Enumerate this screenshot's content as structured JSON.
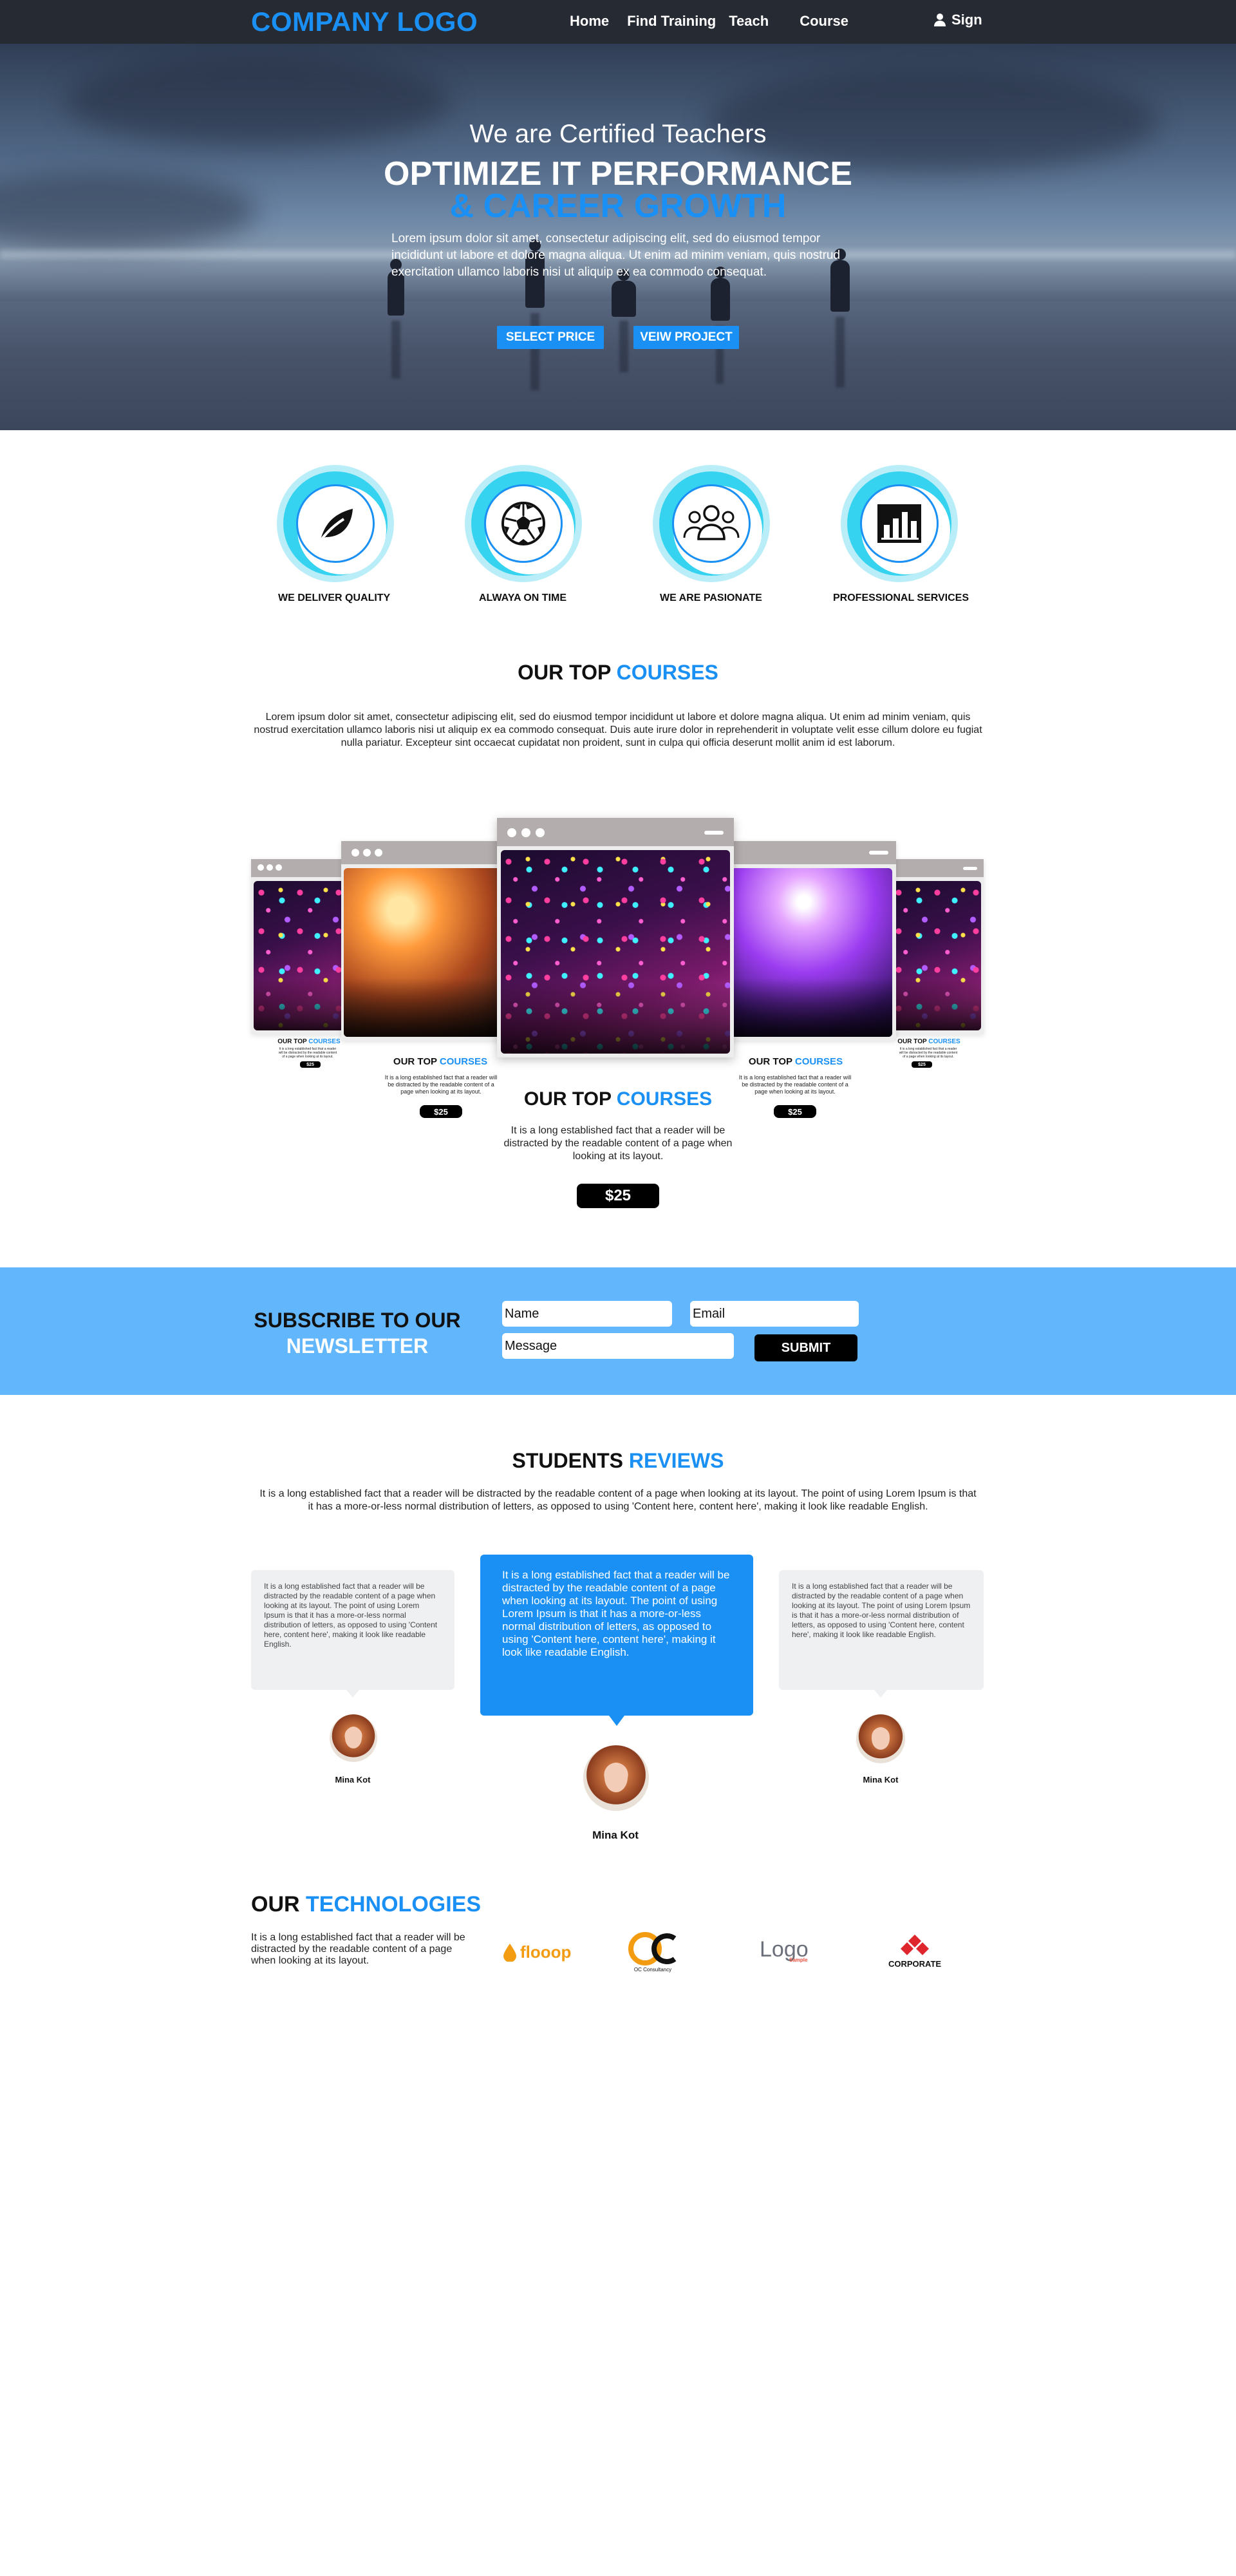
{
  "header": {
    "logo": "COMPANY LOGO",
    "nav": [
      "Home",
      "Find Training",
      "Teach",
      "Course"
    ],
    "sign": "Sign"
  },
  "hero": {
    "subtitle": "We are Certified Teachers",
    "title_line1": "OPTIMIZE IT PERFORMANCE",
    "title_line2": "& CAREER GROWTH",
    "text": "Lorem ipsum dolor sit amet, consectetur adipiscing elit, sed do eiusmod tempor incididunt ut labore et dolore magna aliqua. Ut enim ad minim veniam, quis nostrud exercitation ullamco laboris nisi ut aliquip ex ea commodo consequat.",
    "btn_price": "SELECT PRICE",
    "btn_project": "VEIW PROJECT"
  },
  "features": [
    {
      "label": "WE DELIVER QUALITY",
      "icon": "leaf-icon"
    },
    {
      "label": "ALWAYA ON TIME",
      "icon": "soccer-ball-icon"
    },
    {
      "label": "WE ARE PASIONATE",
      "icon": "team-icon"
    },
    {
      "label": "PROFESSIONAL SERVICES",
      "icon": "bar-chart-icon"
    }
  ],
  "courses": {
    "heading_a": "OUR TOP ",
    "heading_b": "COURSES",
    "intro": "Lorem ipsum dolor sit amet, consectetur adipiscing elit, sed do eiusmod tempor incididunt ut labore et dolore magna aliqua. Ut enim ad minim veniam, quis nostrud exercitation ullamco laboris nisi ut aliquip ex ea commodo consequat. Duis aute irure dolor in reprehenderit in voluptate velit esse cillum dolore eu fugiat nulla pariatur. Excepteur sint occaecat cupidatat non proident, sunt in culpa qui officia deserunt mollit anim id est laborum.",
    "card_heading_a": "OUR TOP ",
    "card_heading_b": "COURSES",
    "card_text": "It is a long established fact that a reader will be distracted by the readable content of a page when looking at its layout.",
    "card_price": "$25"
  },
  "newsletter": {
    "title_a": "SUBSCRIBE TO OUR",
    "title_b": "NEWSLETTER",
    "name_value": "Name",
    "email_value": "Email",
    "message_value": "Message",
    "submit": "SUBMIT"
  },
  "reviews": {
    "heading_a": "STUDENTS ",
    "heading_b": "REVIEWS",
    "intro": "It is a long established fact that a reader will be distracted by the readable content of a page when looking at its layout. The point of using Lorem Ipsum is that it has a more-or-less normal distribution of letters, as opposed to using 'Content here, content here', making it look like readable English.",
    "items": [
      {
        "text": "It is a long established fact that a reader will be distracted by the readable content of a page when looking at its layout. The point of using Lorem Ipsum is that it has a more-or-less normal distribution of letters, as opposed to using 'Content here, content here', making it look like readable English.",
        "name": "Mina Kot"
      },
      {
        "text": "It is a long established fact that a reader will be distracted by the readable content of a page when looking at its layout. The point of using Lorem Ipsum is that it has a more-or-less normal distribution of letters, as opposed to using 'Content here, content here', making it look like readable English.",
        "name": "Mina Kot"
      },
      {
        "text": "It is a long established fact that a reader will be distracted by the readable content of a page when looking at its layout. The point of using Lorem Ipsum is that it has a more-or-less normal distribution of letters, as opposed to using 'Content here, content here', making it look like readable English.",
        "name": "Mina Kot"
      }
    ]
  },
  "technologies": {
    "heading_a": "OUR ",
    "heading_b": "TECHNOLOGIES",
    "text": "It is a long established fact that a reader will be distracted by the readable content of a page when looking at its layout.",
    "logos": [
      {
        "name": "flooop",
        "icon": "drop-icon"
      },
      {
        "name": "OC Consultancy",
        "mark": "OC"
      },
      {
        "name": "Logo",
        "sub": "Sample"
      },
      {
        "name": "CORPORATE",
        "icon": "diamond-icon"
      }
    ]
  },
  "colors": {
    "accent": "#1a90f4",
    "header_bg": "#262a33",
    "newsletter_bg": "#62b6fc",
    "ring_outer": "#b9eef9",
    "ring_mid": "#35d3f0"
  }
}
